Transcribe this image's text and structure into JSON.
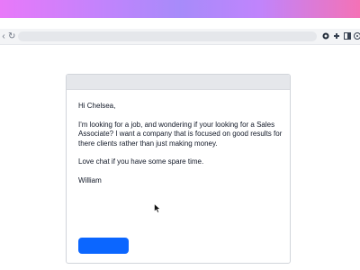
{
  "browser": {
    "toolbar_icons": [
      "back-arrow-icon",
      "refresh-icon",
      "profile-icon",
      "extensions-icon",
      "sidebar-icon",
      "menu-icon"
    ]
  },
  "email": {
    "greeting": "Hi Chelsea,",
    "body": "I'm looking for a job, and wondering if your looking for a Sales Associate? I want a company that is focused on good results for there clients rather than just making money.",
    "closing": "Love chat if you have some spare time.",
    "signature": "William"
  },
  "colors": {
    "accent": "#0b66ff",
    "gradient_start": "#e879f9",
    "gradient_end": "#f472b6"
  }
}
